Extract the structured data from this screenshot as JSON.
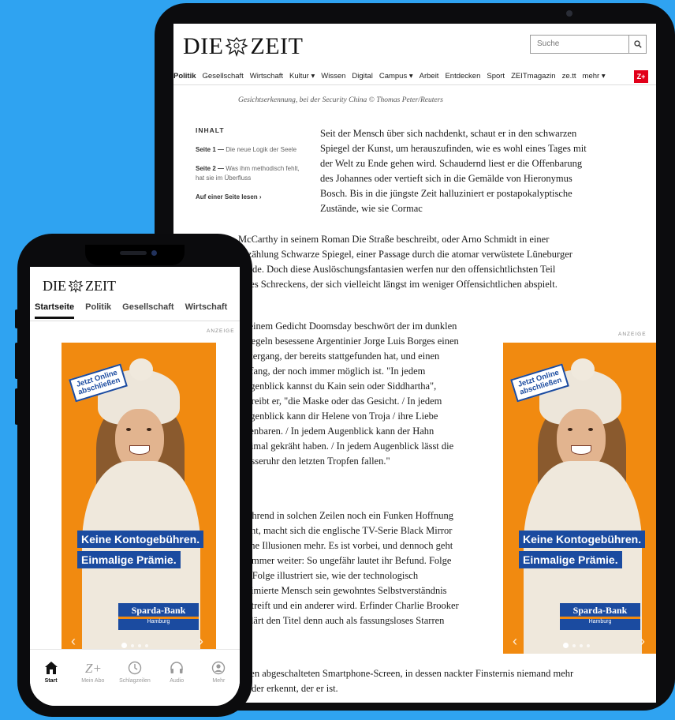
{
  "colors": {
    "background": "#2fa3f1",
    "ad_orange": "#f18a10",
    "ad_blue": "#1b4ba0",
    "zplus_red": "#e2001a"
  },
  "tablet": {
    "logo": {
      "left": "DIE",
      "right": "ZEIT"
    },
    "search": {
      "placeholder": "Suche",
      "icon": "search-icon"
    },
    "nav": [
      "Politik",
      "Gesellschaft",
      "Wirtschaft",
      "Kultur ▾",
      "Wissen",
      "Digital",
      "Campus ▾",
      "Arbeit",
      "Entdecken",
      "Sport",
      "ZEITmagazin",
      "ze.tt",
      "mehr ▾"
    ],
    "zplus": "Z+",
    "caption": "Gesichtserkennung, bei der Security China © Thomas Peter/Reuters",
    "toc": {
      "heading": "INHALT",
      "page1_label": "Seite 1 —",
      "page1_title": "Die neue Logik der Seele",
      "page2_label": "Seite 2 —",
      "page2_title": "Was ihm methodisch fehlt, hat sie im Überfluss",
      "all": "Auf einer Seite lesen ›"
    },
    "text": {
      "p1": "Seit der Mensch über sich nachdenkt, schaut er in den schwarzen Spiegel der Kunst, um herauszufinden, wie es wohl eines Tages mit der Welt zu Ende gehen wird. Schaudernd liest er die Offenbarung des Johannes oder vertieft sich in die Gemälde von Hieronymus Bosch. Bis in die jüngste Zeit halluziniert er postapokalyptische Zustände, wie sie Cormac",
      "p2": "McCarthy in seinem Roman Die Straße beschreibt, oder Arno Schmidt in einer Erzählung Schwarze Spiegel, einer Passage durch die atomar verwüstete Lüneburger Heide. Doch diese Auslöschungsfantasien werfen nur den offensichtlichsten Teil eines Schreckens, der sich vielleicht längst im weniger Offensichtlichen abspielt.",
      "p3": "In einem Gedicht Doomsday beschwört der im dunklen Spiegeln besessene Argentinier Jorge Luis Borges einen Untergang, der bereits stattgefunden hat, und einen Anfang, der noch immer möglich ist. \"In jedem Augenblick kannst du Kain sein oder Siddhartha\", schreibt er, \"die Maske oder das Gesicht. / In jedem Augenblick kann dir Helene von Troja / ihre Liebe offenbaren. / In jedem Augenblick kann der Hahn dreimal gekräht haben. / In jedem Augenblick lässt die Wasseruhr den letzten Tropfen fallen.\"",
      "p4": "Während in solchen Zeilen noch ein Funken Hoffnung glüht, macht sich die englische TV-Serie Black Mirror keine Illusionen mehr. Es ist vorbei, und dennoch geht es immer weiter: So ungefähr lautet ihr Befund. Folge für Folge illustriert sie, wie der technologisch optimierte Mensch sein gewohntes Selbstverständnis abstreift und ein anderer wird. Erfinder Charlie Brooker erklärt den Titel denn auch als fassungsloses Starren auf",
      "p5": "einen abgeschalteten Smartphone-Screen, in dessen nackter Finsternis niemand mehr als der erkennt, der er ist."
    },
    "anzeige": "ANZEIGE"
  },
  "ad": {
    "stamp_line1": "Jetzt Online",
    "stamp_line2": "abschließen",
    "headline1": "Keine Kontogebühren.",
    "headline2": "Einmalige Prämie.",
    "bank_name": "Sparda-Bank",
    "bank_city": "Hamburg",
    "prev": "‹",
    "next": "›"
  },
  "phone": {
    "logo": {
      "left": "DIE",
      "right": "ZEIT"
    },
    "tabs": [
      "Startseite",
      "Politik",
      "Gesellschaft",
      "Wirtschaft"
    ],
    "anzeige": "ANZEIGE",
    "tabbar": [
      {
        "label": "Start",
        "icon": "home-icon"
      },
      {
        "label": "Mein Abo",
        "icon": "zplus-icon"
      },
      {
        "label": "Schlagzeilen",
        "icon": "clock-icon"
      },
      {
        "label": "Audio",
        "icon": "headphones-icon"
      },
      {
        "label": "Mehr",
        "icon": "profile-icon"
      }
    ]
  }
}
